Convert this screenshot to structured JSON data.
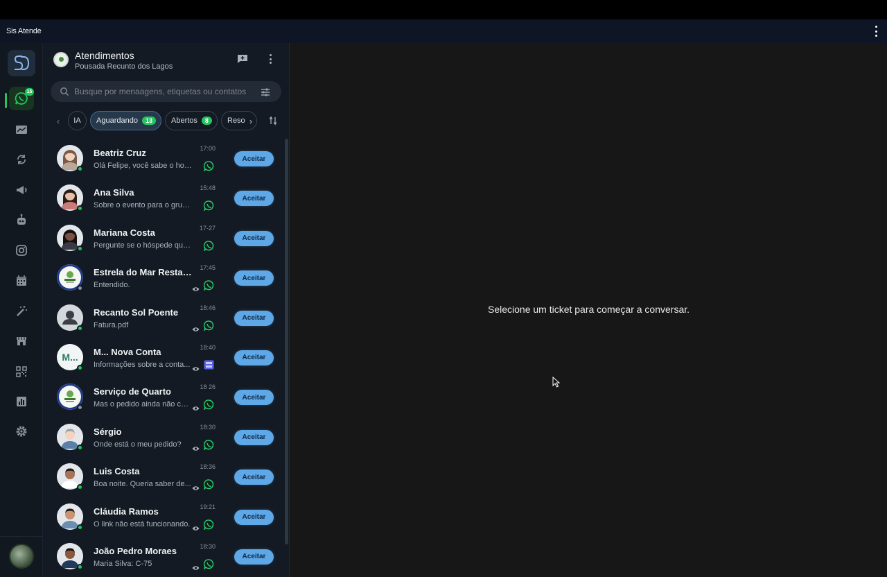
{
  "app": {
    "title": "Sis Atende"
  },
  "rail": {
    "items": [
      {
        "name": "whatsapp-icon",
        "badge": "15",
        "active": true
      },
      {
        "name": "dashboard-icon"
      },
      {
        "name": "sync-icon"
      },
      {
        "name": "megaphone-icon"
      },
      {
        "name": "bot-icon"
      },
      {
        "name": "instagram-icon"
      },
      {
        "name": "calendar-icon"
      },
      {
        "name": "magic-wand-icon"
      },
      {
        "name": "store-icon"
      },
      {
        "name": "qr-code-icon"
      },
      {
        "name": "reports-icon"
      },
      {
        "name": "settings-icon"
      }
    ]
  },
  "header": {
    "title": "Atendimentos",
    "subtitle": "Pousada Recunto dos Lagos"
  },
  "search": {
    "placeholder": "Busque por menaagens, etiquetas ou contatos"
  },
  "tabs": [
    {
      "label": "IA"
    },
    {
      "label": "Aguardando",
      "count": "13",
      "active": true
    },
    {
      "label": "Abertos",
      "count": "8"
    },
    {
      "label": "Reso"
    }
  ],
  "tickets": [
    {
      "name": "Beatriz Cruz",
      "preview": "Olá Felipe, você sabe o horári...",
      "time": "17:00",
      "online": true,
      "eye": false,
      "channel": "whatsapp",
      "avatar": "woman-light",
      "accept": "Aceitar"
    },
    {
      "name": "Ana Silva",
      "preview": "Sobre o evento para o grupo...",
      "time": "15:48",
      "online": true,
      "eye": false,
      "channel": "whatsapp",
      "avatar": "woman-dark-hair",
      "accept": "Aceitar"
    },
    {
      "name": "Mariana Costa",
      "preview": "Pergunte se o hóspede quer...",
      "time": "17-27",
      "online": true,
      "eye": false,
      "channel": "whatsapp",
      "avatar": "woman-black-hair",
      "accept": "Aceitar"
    },
    {
      "name": "Estrela do Mar Restaurante",
      "preview": "Entendido.",
      "time": "17:45",
      "online": false,
      "eye": true,
      "channel": "whatsapp",
      "avatar": "logo",
      "accept": "Aceitar"
    },
    {
      "name": "Recanto Sol Poente",
      "preview": "Fatura.pdf",
      "time": "18:46",
      "online": true,
      "eye": true,
      "channel": "whatsapp",
      "avatar": "generic",
      "accept": "Aceitar"
    },
    {
      "name": "M... Nova Conta",
      "preview": "Informações sobre a conta...",
      "time": "18:40",
      "online": true,
      "eye": true,
      "channel": "panel",
      "avatar": "initials",
      "initials": "M...",
      "accept": "Aceitar"
    },
    {
      "name": "Serviço de Quarto",
      "preview": "Mas o pedido ainda não chegou",
      "time": "18 26",
      "online": false,
      "eye": true,
      "channel": "whatsapp",
      "avatar": "logo",
      "accept": "Aceitar"
    },
    {
      "name": "Sérgio",
      "preview": "Onde está o meu pedido?",
      "time": "18:30",
      "online": true,
      "eye": true,
      "channel": "whatsapp",
      "avatar": "man-light",
      "accept": "Aceitar"
    },
    {
      "name": "Luis Costa",
      "preview": "Boa noite. Queria saber de...",
      "time": "18:36",
      "online": true,
      "eye": true,
      "channel": "whatsapp",
      "avatar": "man-dark",
      "accept": "Aceitar"
    },
    {
      "name": "Cláudia Ramos",
      "preview": "O link não está funcionando.",
      "time": "19:21",
      "online": true,
      "eye": true,
      "channel": "whatsapp",
      "avatar": "man-tan",
      "accept": "Aceitar"
    },
    {
      "name": "João Pedro Moraes",
      "preview": "Maria Silva: C-75",
      "time": "18:30",
      "online": true,
      "eye": true,
      "channel": "whatsapp",
      "avatar": "man-dark2",
      "accept": "Aceitar"
    }
  ],
  "main": {
    "empty_message": "Selecione um ticket para começar a conversar."
  },
  "colors": {
    "accent": "#22c55e",
    "accept_button": "#5fa8e8",
    "background": "#171717",
    "panel": "#131a23"
  }
}
